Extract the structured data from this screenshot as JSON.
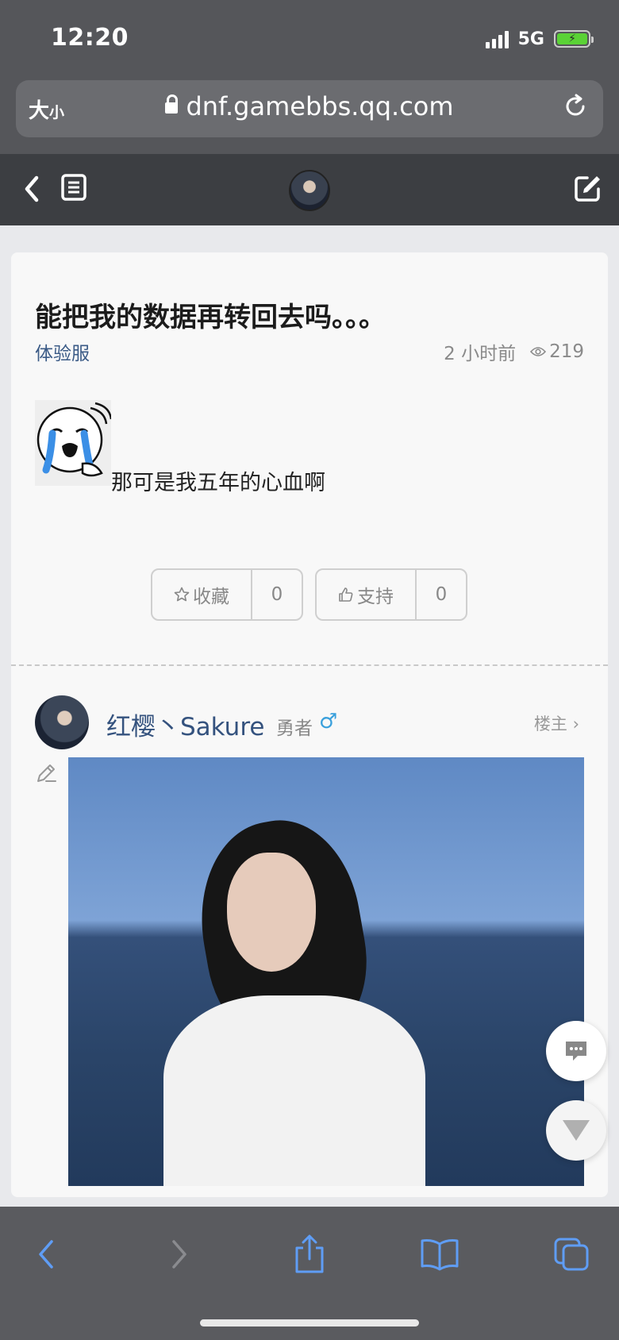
{
  "status_bar": {
    "time": "12:20",
    "network": "5G"
  },
  "browser": {
    "text_size_label_big": "大",
    "text_size_label_small": "小",
    "url": "dnf.gamebbs.qq.com"
  },
  "post": {
    "title": "能把我的数据再转回去吗。。。",
    "category": "体验服",
    "time_ago": "2 小时前",
    "views": "219",
    "content_text": "那可是我五年的心血啊"
  },
  "actions": {
    "favorite_label": "收藏",
    "favorite_count": "0",
    "support_label": "支持",
    "support_count": "0"
  },
  "author": {
    "name": "红樱丶Sakure",
    "rank": "勇者",
    "gender_symbol": "♂",
    "role": "楼主 ›"
  },
  "colors": {
    "link_blue": "#34527e",
    "gender_blue": "#3aa0dc",
    "toolbar_icon": "#5f9df5"
  },
  "icons": [
    "back-icon",
    "list-icon",
    "edit-icon",
    "lock-icon",
    "reload-icon",
    "star-icon",
    "thumbs-up-icon",
    "eye-icon",
    "pencil-icon",
    "comment-icon",
    "down-arrow-icon",
    "share-icon",
    "bookmarks-icon",
    "tabs-icon"
  ]
}
